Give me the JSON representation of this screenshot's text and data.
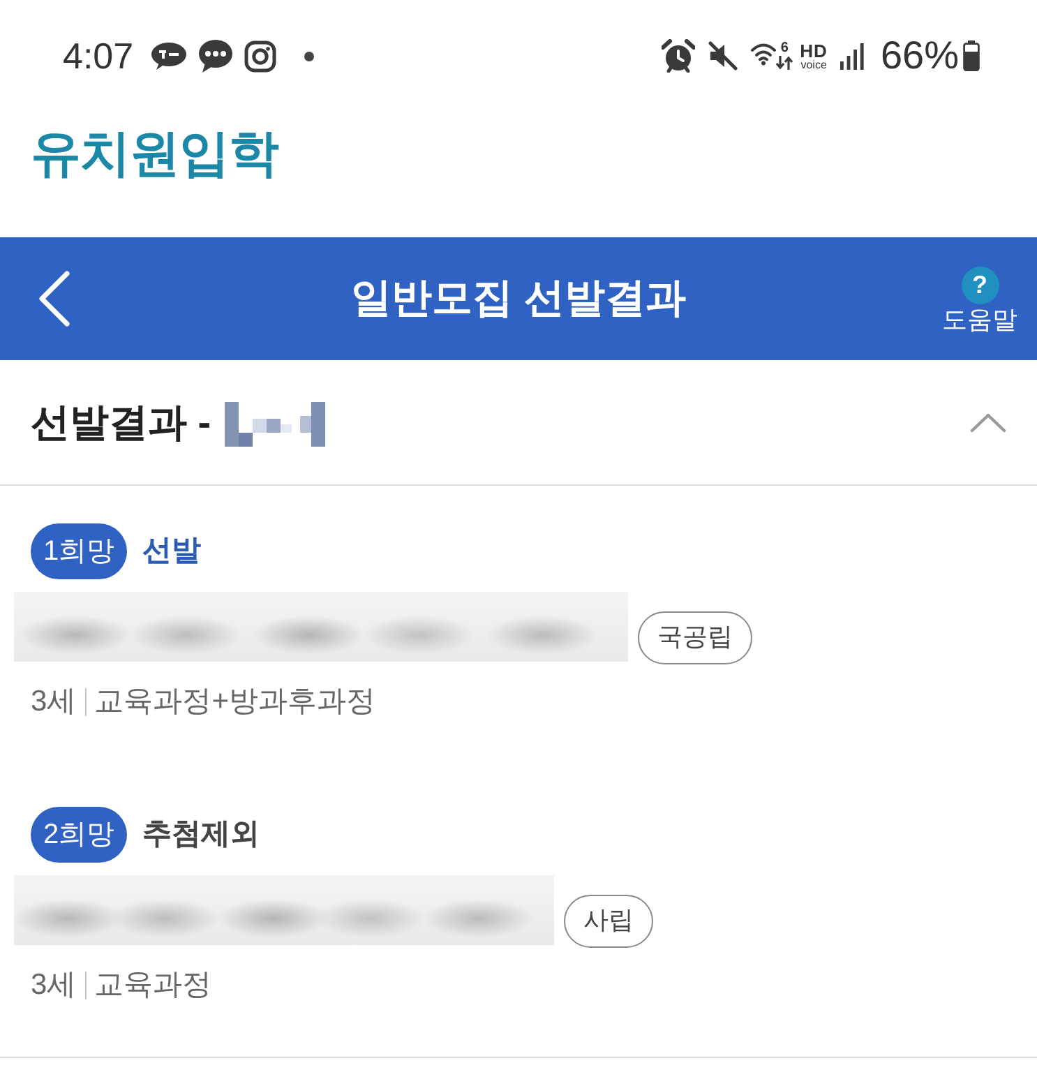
{
  "status_bar": {
    "time": "4:07",
    "wifi_label": "6",
    "hd_label": "HD",
    "voice_label": "voice",
    "battery": "66%"
  },
  "app_title": "유치원입학",
  "header": {
    "title": "일반모집 선발결과",
    "help_glyph": "?",
    "help_label": "도움말"
  },
  "section": {
    "title": "선발결과 -",
    "expanded": true
  },
  "choices": [
    {
      "rank": "1희망",
      "result": {
        "label": "선발",
        "kind": "selected"
      },
      "type": "국공립",
      "age": "3세",
      "program": "교육과정+방과후과정"
    },
    {
      "rank": "2희망",
      "result": {
        "label": "추첨제외",
        "kind": "excluded"
      },
      "type": "사립",
      "age": "3세",
      "program": "교육과정"
    }
  ]
}
